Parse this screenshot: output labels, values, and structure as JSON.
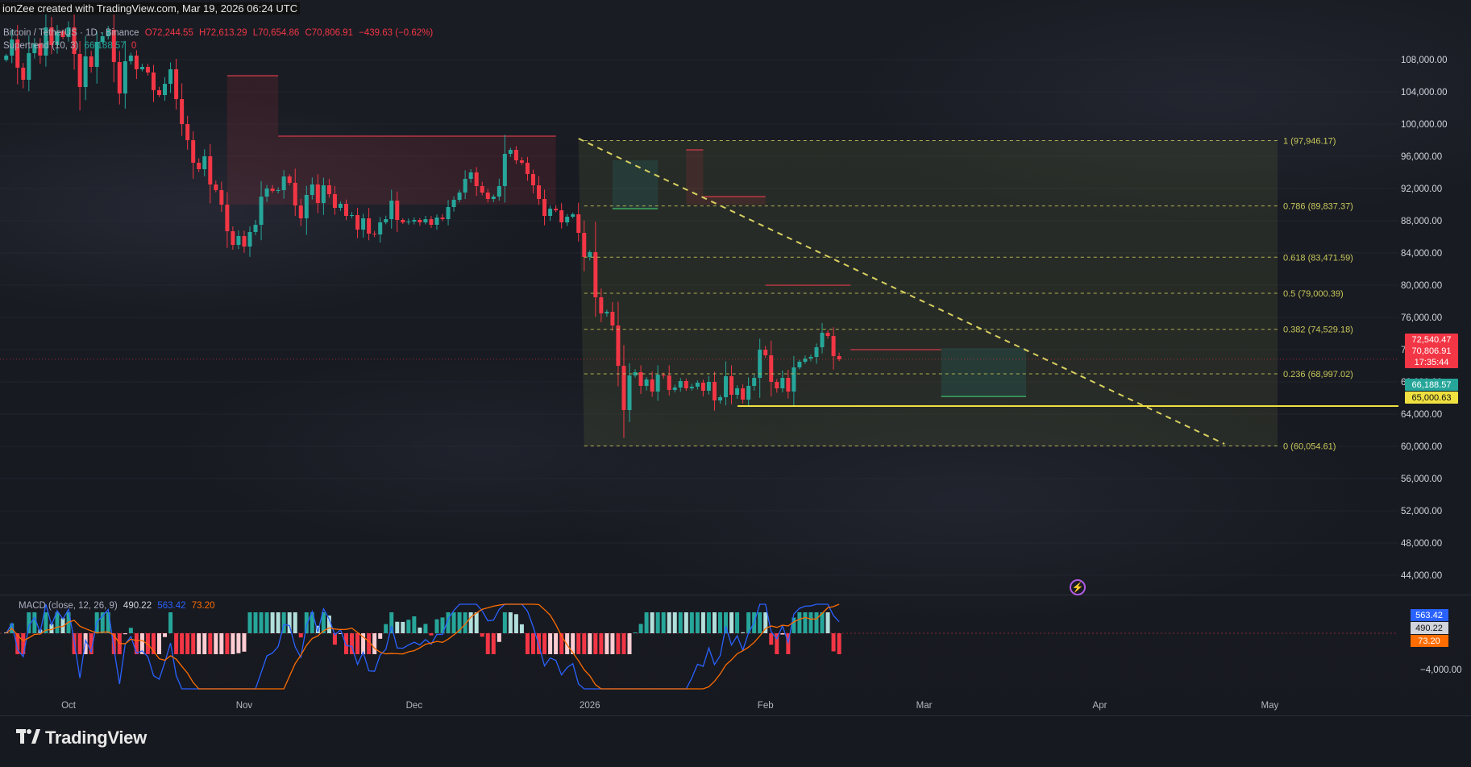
{
  "credit": "ionZee created with TradingView.com, Mar 19, 2026 06:24 UTC",
  "legend": {
    "symbol": "Bitcoin / TetherUS · 1D · Binance",
    "open": "O72,244.55",
    "high": "H72,613.29",
    "low": "L70,654.86",
    "close": "C70,806.91",
    "change": "−439.63 (−0.62%)",
    "supertrend_label": "Supertrend (10, 3)",
    "supertrend_value": "66,188.57",
    "supertrend_extra": "0",
    "macd_label": "MACD (close, 12, 26, 9)",
    "macd_v1": "490.22",
    "macd_v2": "563.42",
    "macd_v3": "73.20"
  },
  "brand": "TradingView",
  "icons": [
    "tradingview-logo-icon",
    "lightning-icon"
  ],
  "colors": {
    "up": "#26a69a",
    "down": "#f23645",
    "fib": "#c8c85a",
    "support": "#f0e040",
    "macd": "#2962ff",
    "signal": "#ff6d00"
  },
  "chart_data": {
    "type": "candlestick",
    "symbol": "BTCUSDT",
    "timeframe": "1D",
    "x_ticks": [
      "Oct",
      "Nov",
      "Dec",
      "2026",
      "Feb",
      "Mar",
      "Apr",
      "May"
    ],
    "y_ticks": [
      "108,000.00",
      "104,000.00",
      "100,000.00",
      "96,000.00",
      "92,000.00",
      "88,000.00",
      "84,000.00",
      "80,000.00",
      "76,000.00",
      "72,000.00",
      "68,000.00",
      "64,000.00",
      "60,000.00",
      "56,000.00",
      "52,000.00",
      "48,000.00",
      "44,000.00"
    ],
    "y_range": [
      42000,
      112000
    ],
    "closes_daily_approx": [
      108500,
      110500,
      107000,
      105500,
      108800,
      110000,
      108500,
      112000,
      109800,
      111500,
      110800,
      112000,
      108700,
      104600,
      108400,
      107100,
      110200,
      110900,
      111700,
      107700,
      103800,
      107800,
      108500,
      106800,
      107100,
      106400,
      104200,
      103600,
      105000,
      106800,
      103100,
      100000,
      98000,
      95200,
      94400,
      96000,
      92500,
      91800,
      90000,
      86700,
      85000,
      86100,
      84800,
      86600,
      87500,
      91000,
      92000,
      91700,
      91800,
      93500,
      92700,
      89900,
      88300,
      91200,
      92500,
      90200,
      92400,
      91300,
      89600,
      90100,
      88600,
      88700,
      86900,
      88300,
      86400,
      86300,
      87800,
      88200,
      90500,
      88100,
      87800,
      87900,
      88100,
      87800,
      88200,
      87500,
      88400,
      88200,
      89700,
      90600,
      91500,
      93200,
      94000,
      92300,
      91500,
      90700,
      91000,
      92300,
      96300,
      96800,
      95500,
      95200,
      93800,
      92400,
      90700,
      88600,
      89500,
      89300,
      87800,
      88500,
      88800,
      86500,
      83500,
      84100,
      78500,
      76500,
      76700,
      75000,
      70000,
      64500,
      68800,
      69200,
      67500,
      68300,
      66800,
      68900,
      68800,
      67000,
      67300,
      68100,
      67200,
      67400,
      67900,
      66900,
      68000,
      65700,
      66100,
      68700,
      66400,
      67200,
      65800,
      67500,
      68500,
      72000,
      71300,
      68000,
      67200,
      68500,
      66800,
      69800,
      70500,
      70900,
      71100,
      72300,
      74100,
      73700,
      71200,
      70807
    ],
    "supertrend": {
      "value": 66188.57,
      "state": "bullish",
      "resistance_segments": [
        {
          "from": "2025-10-29",
          "to": "2025-11-07",
          "level": 106000
        },
        {
          "from": "2025-11-07",
          "to": "2025-12-26",
          "level": 98500
        },
        {
          "from": "2026-01-18",
          "to": "2026-01-21",
          "level": 96800
        },
        {
          "from": "2026-01-21",
          "to": "2026-02-01",
          "level": 91000
        },
        {
          "from": "2026-02-01",
          "to": "2026-02-16",
          "level": 80000
        },
        {
          "from": "2026-02-16",
          "to": "2026-03-04",
          "level": 72000
        }
      ],
      "support_segments": [
        {
          "from": "2026-01-05",
          "to": "2026-01-13",
          "level": 89500
        },
        {
          "from": "2026-03-04",
          "to": "2026-03-19",
          "level": 66188.57
        }
      ]
    },
    "fibonacci": [
      {
        "ratio": "1",
        "price": 97946.17,
        "label": "1 (97,946.17)"
      },
      {
        "ratio": "0.786",
        "price": 89837.37,
        "label": "0.786 (89,837.37)"
      },
      {
        "ratio": "0.618",
        "price": 83471.59,
        "label": "0.618 (83,471.59)"
      },
      {
        "ratio": "0.5",
        "price": 79000.39,
        "label": "0.5 (79,000.39)"
      },
      {
        "ratio": "0.382",
        "price": 74529.18,
        "label": "0.382 (74,529.18)"
      },
      {
        "ratio": "0.236",
        "price": 68997.02,
        "label": "0.236 (68,997.02)"
      },
      {
        "ratio": "0",
        "price": 60054.61,
        "label": "0 (60,054.61)"
      }
    ],
    "support_line": {
      "price": 65000.63
    },
    "trendline": {
      "from": {
        "date": "2025-12-30",
        "price": 98200
      },
      "to": {
        "date": "2026-04-23",
        "price": 60300
      },
      "style": "dashed"
    },
    "price_labels": [
      {
        "text": "72,540.47",
        "price": 72540.47,
        "color": "#f23645"
      },
      {
        "text": "70,806.91",
        "price": 70806.91,
        "color": "#f23645"
      },
      {
        "text": "17:35:44",
        "price": 70806.91,
        "color": "#f23645",
        "below": true
      },
      {
        "text": "66,188.57",
        "price": 66188.57,
        "color": "#26a69a"
      },
      {
        "text": "65,000.63",
        "price": 65000.63,
        "color": "#f0e040"
      }
    ],
    "macd": {
      "params": "close, 12, 26, 9",
      "macd": 563.42,
      "signal": 490.22,
      "histogram": 73.2,
      "y_tick": "−4,000.00",
      "labels": [
        {
          "text": "563.42",
          "color": "#2962ff"
        },
        {
          "text": "490.22",
          "color": "#d1d4dc"
        },
        {
          "text": "73.20",
          "color": "#ff6d00"
        }
      ]
    }
  }
}
